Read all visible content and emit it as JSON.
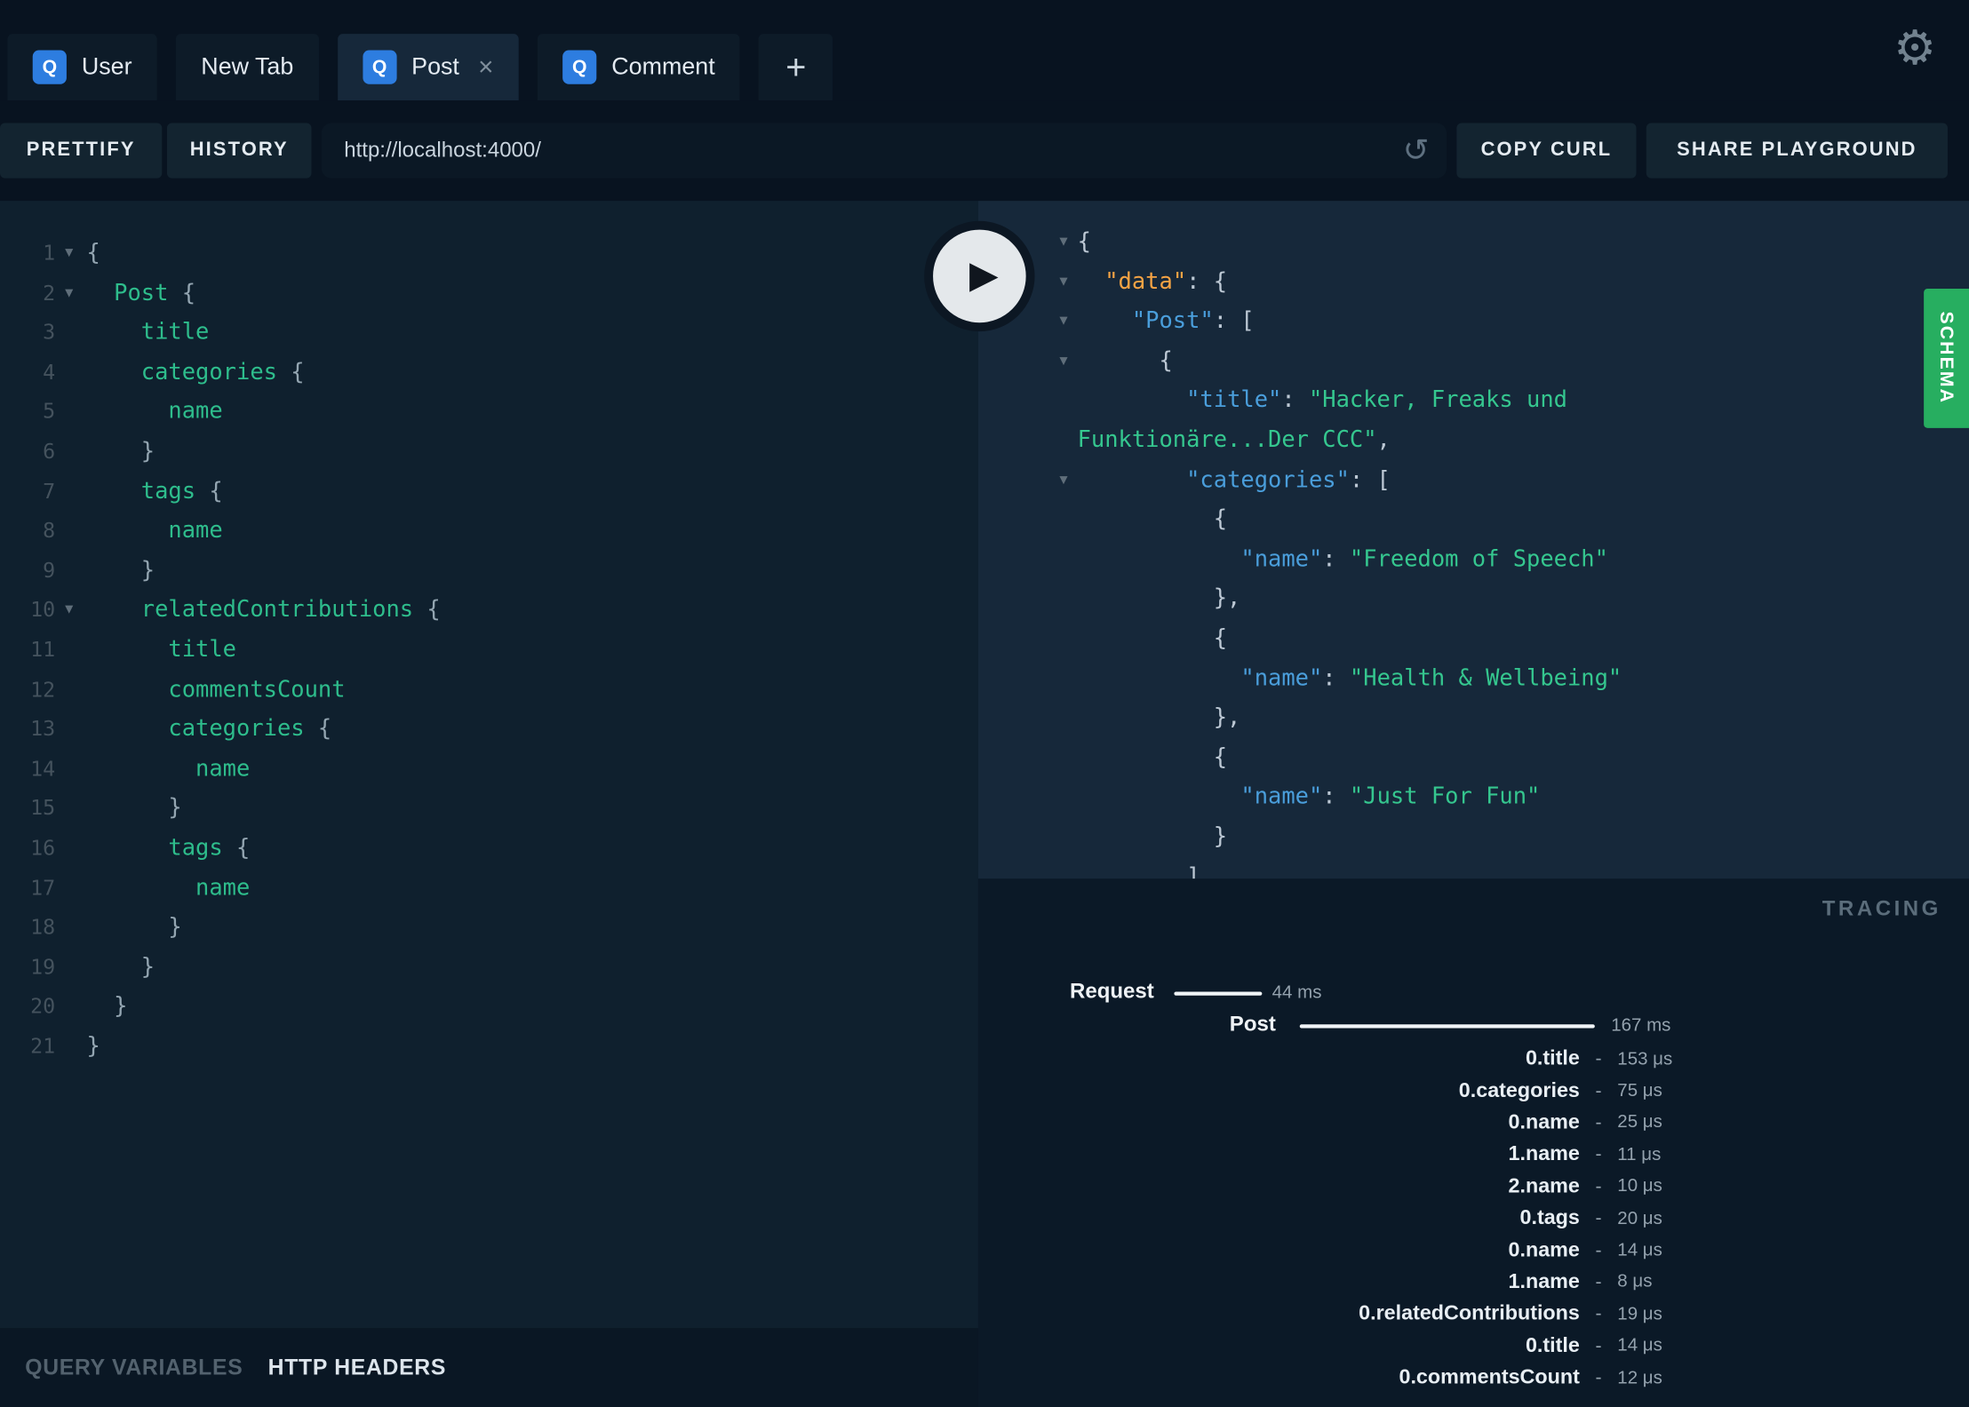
{
  "tabs": [
    {
      "label": "User",
      "badge": "Q"
    },
    {
      "label": "New Tab",
      "badge": ""
    },
    {
      "label": "Post",
      "badge": "Q",
      "close": "×"
    },
    {
      "label": "Comment",
      "badge": "Q"
    }
  ],
  "icons": {
    "gear": "⚙",
    "reload": "↺",
    "close": "×",
    "fold": "▾",
    "play": "▶",
    "plus": "+"
  },
  "toolbar": {
    "prettify_label": "PRETTIFY",
    "history_label": "HISTORY",
    "url_value": "http://localhost:4000/",
    "copy_curl_label": "COPY CURL",
    "share_label": "SHARE PLAYGROUND"
  },
  "editor": {
    "lines": [
      {
        "n": 1,
        "fold": true,
        "seg": [
          [
            "{",
            "p"
          ]
        ]
      },
      {
        "n": 2,
        "fold": true,
        "seg": [
          [
            "  ",
            "p"
          ],
          [
            "Post",
            "f"
          ],
          [
            " {",
            "p"
          ]
        ]
      },
      {
        "n": 3,
        "fold": false,
        "seg": [
          [
            "    ",
            "p"
          ],
          [
            "title",
            "f"
          ]
        ]
      },
      {
        "n": 4,
        "fold": false,
        "seg": [
          [
            "    ",
            "p"
          ],
          [
            "categories",
            "f"
          ],
          [
            " {",
            "p"
          ]
        ]
      },
      {
        "n": 5,
        "fold": false,
        "seg": [
          [
            "      ",
            "p"
          ],
          [
            "name",
            "f"
          ]
        ]
      },
      {
        "n": 6,
        "fold": false,
        "seg": [
          [
            "    }",
            "p"
          ]
        ]
      },
      {
        "n": 7,
        "fold": false,
        "seg": [
          [
            "    ",
            "p"
          ],
          [
            "tags",
            "f"
          ],
          [
            " {",
            "p"
          ]
        ]
      },
      {
        "n": 8,
        "fold": false,
        "seg": [
          [
            "      ",
            "p"
          ],
          [
            "name",
            "f"
          ]
        ]
      },
      {
        "n": 9,
        "fold": false,
        "seg": [
          [
            "    }",
            "p"
          ]
        ]
      },
      {
        "n": 10,
        "fold": true,
        "seg": [
          [
            "    ",
            "p"
          ],
          [
            "relatedContributions",
            "f"
          ],
          [
            " {",
            "p"
          ]
        ]
      },
      {
        "n": 11,
        "fold": false,
        "seg": [
          [
            "      ",
            "p"
          ],
          [
            "title",
            "f"
          ]
        ]
      },
      {
        "n": 12,
        "fold": false,
        "seg": [
          [
            "      ",
            "p"
          ],
          [
            "commentsCount",
            "f"
          ]
        ]
      },
      {
        "n": 13,
        "fold": false,
        "seg": [
          [
            "      ",
            "p"
          ],
          [
            "categories",
            "f"
          ],
          [
            " {",
            "p"
          ]
        ]
      },
      {
        "n": 14,
        "fold": false,
        "seg": [
          [
            "        ",
            "p"
          ],
          [
            "name",
            "f"
          ]
        ]
      },
      {
        "n": 15,
        "fold": false,
        "seg": [
          [
            "      }",
            "p"
          ]
        ]
      },
      {
        "n": 16,
        "fold": false,
        "seg": [
          [
            "      ",
            "p"
          ],
          [
            "tags",
            "f"
          ],
          [
            " {",
            "p"
          ]
        ]
      },
      {
        "n": 17,
        "fold": false,
        "seg": [
          [
            "        ",
            "p"
          ],
          [
            "name",
            "f"
          ]
        ]
      },
      {
        "n": 18,
        "fold": false,
        "seg": [
          [
            "      }",
            "p"
          ]
        ]
      },
      {
        "n": 19,
        "fold": false,
        "seg": [
          [
            "    }",
            "p"
          ]
        ]
      },
      {
        "n": 20,
        "fold": false,
        "seg": [
          [
            "  }",
            "p"
          ]
        ]
      },
      {
        "n": 21,
        "fold": false,
        "seg": [
          [
            "}",
            "p"
          ]
        ]
      }
    ]
  },
  "result": {
    "lines": [
      {
        "fold": true,
        "seg": [
          [
            "{",
            "p"
          ]
        ]
      },
      {
        "fold": true,
        "seg": [
          [
            "  ",
            "p"
          ],
          [
            "\"data\"",
            "d"
          ],
          [
            ": {",
            "p"
          ]
        ]
      },
      {
        "fold": true,
        "seg": [
          [
            "    ",
            "p"
          ],
          [
            "\"Post\"",
            "k"
          ],
          [
            ": [",
            "p"
          ]
        ]
      },
      {
        "fold": true,
        "seg": [
          [
            "      {",
            "p"
          ]
        ]
      },
      {
        "fold": false,
        "seg": [
          [
            "        ",
            "p"
          ],
          [
            "\"title\"",
            "k"
          ],
          [
            ": ",
            "p"
          ],
          [
            "\"Hacker, Freaks und",
            "s"
          ]
        ]
      },
      {
        "fold": false,
        "seg": [
          [
            "Funktionäre...Der CCC\"",
            "s"
          ],
          [
            ",",
            "p"
          ]
        ]
      },
      {
        "fold": true,
        "seg": [
          [
            "        ",
            "p"
          ],
          [
            "\"categories\"",
            "k"
          ],
          [
            ": [",
            "p"
          ]
        ]
      },
      {
        "fold": false,
        "seg": [
          [
            "          {",
            "p"
          ]
        ]
      },
      {
        "fold": false,
        "seg": [
          [
            "            ",
            "p"
          ],
          [
            "\"name\"",
            "k"
          ],
          [
            ": ",
            "p"
          ],
          [
            "\"Freedom of Speech\"",
            "s"
          ]
        ]
      },
      {
        "fold": false,
        "seg": [
          [
            "          },",
            "p"
          ]
        ]
      },
      {
        "fold": false,
        "seg": [
          [
            "          {",
            "p"
          ]
        ]
      },
      {
        "fold": false,
        "seg": [
          [
            "            ",
            "p"
          ],
          [
            "\"name\"",
            "k"
          ],
          [
            ": ",
            "p"
          ],
          [
            "\"Health & Wellbeing\"",
            "s"
          ]
        ]
      },
      {
        "fold": false,
        "seg": [
          [
            "          },",
            "p"
          ]
        ]
      },
      {
        "fold": false,
        "seg": [
          [
            "          {",
            "p"
          ]
        ]
      },
      {
        "fold": false,
        "seg": [
          [
            "            ",
            "p"
          ],
          [
            "\"name\"",
            "k"
          ],
          [
            ": ",
            "p"
          ],
          [
            "\"Just For Fun\"",
            "s"
          ]
        ]
      },
      {
        "fold": false,
        "seg": [
          [
            "          }",
            "p"
          ]
        ]
      },
      {
        "fold": false,
        "seg": [
          [
            "        ]",
            "p"
          ]
        ]
      }
    ]
  },
  "tracing": {
    "title": "TRACING",
    "spans": [
      {
        "label": "Request",
        "value": "44 ms"
      },
      {
        "label": "Post",
        "value": "167 ms"
      }
    ],
    "rows": [
      {
        "label": "0.title",
        "value": "153 μs"
      },
      {
        "label": "0.categories",
        "value": "75 μs"
      },
      {
        "label": "0.name",
        "value": "25 μs"
      },
      {
        "label": "1.name",
        "value": "11 μs"
      },
      {
        "label": "2.name",
        "value": "10 μs"
      },
      {
        "label": "0.tags",
        "value": "20 μs"
      },
      {
        "label": "0.name",
        "value": "14 μs"
      },
      {
        "label": "1.name",
        "value": "8 μs"
      },
      {
        "label": "0.relatedContributions",
        "value": "19 μs"
      },
      {
        "label": "0.title",
        "value": "14 μs"
      },
      {
        "label": "0.commentsCount",
        "value": "12 μs"
      }
    ]
  },
  "footer": {
    "query_variables": "QUERY VARIABLES",
    "http_headers": "HTTP HEADERS"
  },
  "schema_tab_label": "SCHEMA",
  "colors": {
    "topbar": "#081320",
    "tab_inactive": "#0d1b28",
    "tab_active": "#16283a",
    "editor": "#0f202e",
    "result": "#16283a",
    "tracing": "#0b1927",
    "footer": "#0a1724",
    "button": "#132430",
    "input": "#0b1825",
    "accent": "#2d7de0",
    "schema": "#27ae60",
    "field": "#2ebd8c",
    "key": "#4a9edb",
    "dataKey": "#f5a344",
    "string": "#35c78f"
  }
}
